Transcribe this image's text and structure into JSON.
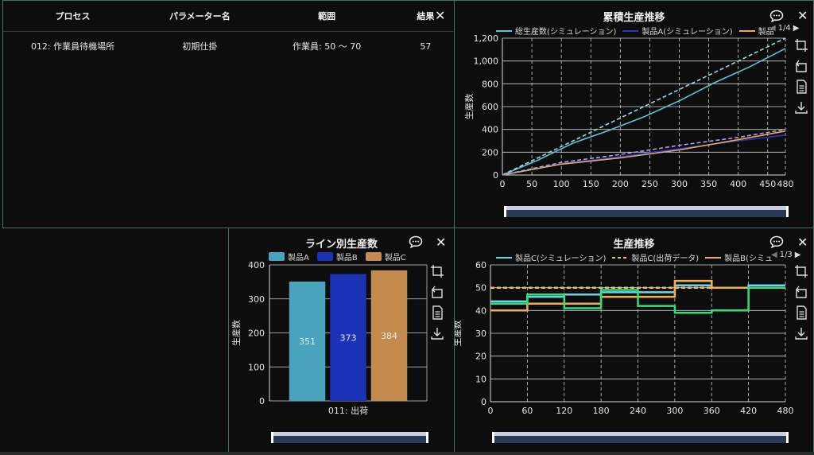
{
  "table": {
    "headers": [
      "プロセス",
      "パラメーター名",
      "範囲",
      "結果"
    ],
    "rows": [
      [
        "012: 作業員待機場所",
        "初期仕掛",
        "作業員: 50 〜 70",
        "57"
      ]
    ]
  },
  "panels": {
    "cumulative": {
      "title": "累積生産推移",
      "pager": "1/4"
    },
    "line_bar": {
      "title": "ライン別生産数"
    },
    "production": {
      "title": "生産推移",
      "pager": "1/3"
    }
  },
  "colors": {
    "panel_border": "#3f6f6f",
    "grid": "#cfcfcf",
    "total_sim": "#5bc4da",
    "productA_sim": "#2536c9",
    "productC_sim": "#e9a861",
    "productA_bar": "#4aa3bd",
    "productB_bar": "#1b32b6",
    "productC_bar": "#c38c4e",
    "prodC_sim_line": "#6cd6e6",
    "prodB_sim_line": "#f0b050",
    "green_line": "#30e07a"
  },
  "chart_data": [
    {
      "type": "line",
      "title": "累積生産推移",
      "ylabel": "生産数",
      "xlim": [
        0,
        480
      ],
      "ylim": [
        0,
        1200
      ],
      "x_ticks": [
        0,
        50,
        100,
        150,
        200,
        250,
        300,
        350,
        400,
        450,
        480
      ],
      "y_ticks": [
        0,
        200,
        400,
        600,
        800,
        1000,
        1200
      ],
      "y_tick_labels": [
        "0",
        "200",
        "400",
        "600",
        "800",
        "1,000",
        "1,200"
      ],
      "legend_labels": [
        "総生産数(シミュレーション)",
        "製品A(シミュレーション)",
        "製品"
      ],
      "series": [
        {
          "name": "総生産数(シミュレーション)",
          "style": "solid",
          "color": "#5bc4da",
          "points": [
            [
              0,
              0
            ],
            [
              60,
              130
            ],
            [
              120,
              280
            ],
            [
              180,
              390
            ],
            [
              240,
              510
            ],
            [
              300,
              650
            ],
            [
              360,
              810
            ],
            [
              420,
              950
            ],
            [
              480,
              1110
            ]
          ]
        },
        {
          "style": "dashed",
          "color": "#9ad9e8",
          "points": [
            [
              0,
              0
            ],
            [
              100,
              250
            ],
            [
              200,
              500
            ],
            [
              300,
              750
            ],
            [
              400,
              1000
            ],
            [
              480,
              1200
            ]
          ]
        },
        {
          "name": "製品A(シミュレーション)",
          "style": "solid",
          "color": "#2536c9",
          "points": [
            [
              0,
              0
            ],
            [
              100,
              100
            ],
            [
              200,
              160
            ],
            [
              300,
              230
            ],
            [
              400,
              300
            ],
            [
              480,
              350
            ]
          ]
        },
        {
          "style": "solid",
          "color": "#e9a861",
          "points": [
            [
              0,
              0
            ],
            [
              100,
              95
            ],
            [
              200,
              150
            ],
            [
              300,
              220
            ],
            [
              400,
              310
            ],
            [
              480,
              385
            ]
          ]
        },
        {
          "style": "dashed",
          "color": "#b69be0",
          "points": [
            [
              0,
              0
            ],
            [
              100,
              110
            ],
            [
              200,
              180
            ],
            [
              300,
              260
            ],
            [
              400,
              330
            ],
            [
              480,
              400
            ]
          ]
        }
      ]
    },
    {
      "type": "bar",
      "title": "ライン別生産数",
      "categories": [
        "011: 出荷"
      ],
      "ylabel": "生産数",
      "ylim": [
        0,
        400
      ],
      "y_ticks": [
        0,
        100,
        200,
        300,
        400
      ],
      "series": [
        {
          "name": "製品A",
          "values": [
            351
          ],
          "color": "#4aa3bd"
        },
        {
          "name": "製品B",
          "values": [
            373
          ],
          "color": "#1b32b6"
        },
        {
          "name": "製品C",
          "values": [
            384
          ],
          "color": "#c38c4e"
        }
      ]
    },
    {
      "type": "line",
      "title": "生産推移",
      "ylabel": "生産数",
      "xlim": [
        0,
        480
      ],
      "ylim": [
        0,
        60
      ],
      "x_ticks": [
        0,
        60,
        120,
        180,
        240,
        300,
        360,
        420,
        480
      ],
      "y_ticks": [
        0,
        10,
        20,
        30,
        40,
        50,
        60
      ],
      "legend_labels": [
        "製品C(シミュレーション)",
        "製品C(出荷データ)",
        "製品B(シミュ"
      ],
      "series": [
        {
          "name": "製品C(出荷データ)",
          "style": "dashed",
          "color": "#f0c070",
          "steps": [
            [
              0,
              50
            ],
            [
              480,
              50
            ]
          ]
        },
        {
          "name": "製品C(シミュレーション)",
          "style": "step",
          "color": "#6cd6e6",
          "steps": [
            [
              0,
              44
            ],
            [
              60,
              46
            ],
            [
              120,
              47
            ],
            [
              180,
              48
            ],
            [
              240,
              48
            ],
            [
              300,
              51
            ],
            [
              360,
              50
            ],
            [
              420,
              51
            ],
            [
              480,
              51
            ]
          ]
        },
        {
          "name": "製品B(シミュ",
          "style": "step",
          "color": "#f0b050",
          "steps": [
            [
              0,
              40
            ],
            [
              60,
              43
            ],
            [
              120,
              43
            ],
            [
              180,
              46
            ],
            [
              240,
              46
            ],
            [
              300,
              53
            ],
            [
              360,
              50
            ],
            [
              420,
              50
            ],
            [
              480,
              50
            ]
          ]
        },
        {
          "style": "step",
          "color": "#30e07a",
          "steps": [
            [
              0,
              43
            ],
            [
              60,
              47
            ],
            [
              120,
              41
            ],
            [
              180,
              49
            ],
            [
              240,
              42
            ],
            [
              300,
              39
            ],
            [
              360,
              40
            ],
            [
              420,
              50
            ],
            [
              480,
              50
            ]
          ]
        }
      ]
    }
  ]
}
